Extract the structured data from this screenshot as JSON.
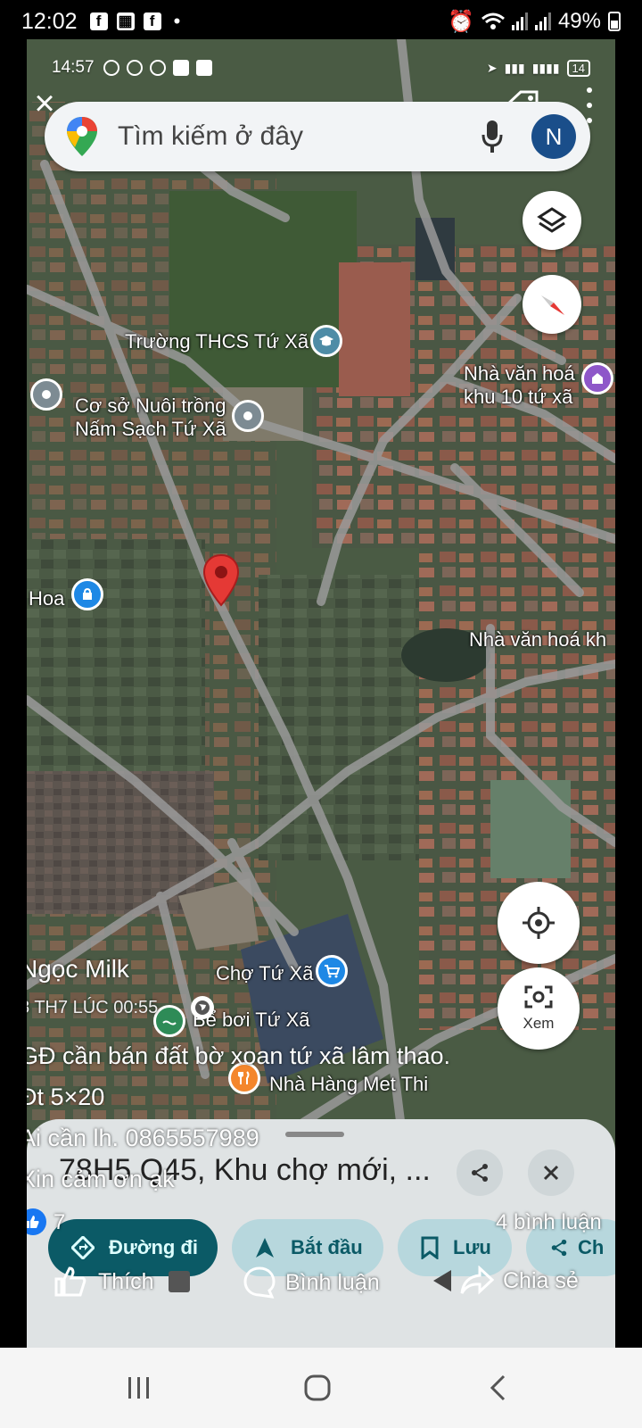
{
  "status": {
    "time": "12:02",
    "battery": "49%",
    "apps": [
      "f",
      "▦",
      "f"
    ]
  },
  "inner_status": {
    "time": "14:57",
    "battery": "14"
  },
  "search": {
    "placeholder": "Tìm kiếm ở đây",
    "avatar_letter": "N"
  },
  "map_labels": {
    "school": "Trường THCS Tứ Xã",
    "culture_house_10_line1": "Nhà văn hoá",
    "culture_house_10_line2": "khu 10 tứ xã",
    "mushroom_line1": "Cơ sở Nuôi trồng",
    "mushroom_line2": "Nấm Sạch Tứ Xã",
    "hoa": "Hoa",
    "culture_house_right": "Nhà văn hoá kh",
    "market": "Chợ Tứ Xã",
    "pool": "Bể bơi Tứ Xã",
    "restaurant": "Nhà Hàng Met Thi"
  },
  "fab": {
    "explore_label": "Xem"
  },
  "post": {
    "author": "Ngọc Milk",
    "date": "8 TH7 LÚC 00:55",
    "line1": "GĐ cần bán đất bờ xoan tứ xã lâm thao.",
    "line2": "Đt 5×20",
    "line3": "Ai cần lh. 0865557989",
    "line4": "Xin cảm ơn ạk",
    "likes": "7",
    "comments": "4 bình luận",
    "like_label": "Thích",
    "comment_label": "Bình luận",
    "share_label": "Chia sẻ"
  },
  "sheet": {
    "title": "78H5 Q45, Khu chợ mới, ...",
    "directions": "Đường đi",
    "start": "Bắt đầu",
    "save": "Lưu",
    "share_partial": "Ch"
  },
  "colors": {
    "primary": "#0b5a66",
    "secondary": "#b7d7dd",
    "marker": "#e53935",
    "facebook_blue": "#1877f2"
  }
}
